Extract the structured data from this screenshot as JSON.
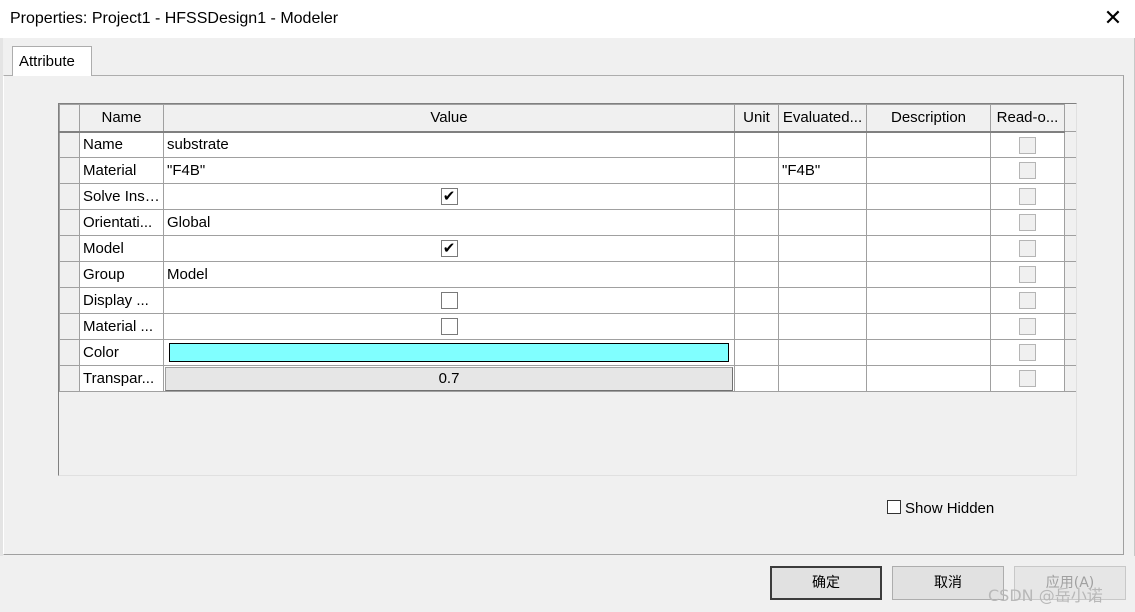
{
  "window": {
    "title": "Properties: Project1 - HFSSDesign1 - Modeler",
    "close_glyph": "✕"
  },
  "tabs": [
    {
      "label": "Attribute",
      "selected": true
    }
  ],
  "table": {
    "columns": [
      "Name",
      "Value",
      "Unit",
      "Evaluated...",
      "Description",
      "Read-o..."
    ],
    "rows": [
      {
        "name": "Name",
        "value": "substrate",
        "unit": "",
        "evaluated": "",
        "description": "",
        "readonly": false
      },
      {
        "name": "Material",
        "value": "\"F4B\"",
        "unit": "",
        "evaluated": "\"F4B\"",
        "description": "",
        "readonly": false
      },
      {
        "name": "Solve Insi...",
        "value": "",
        "value_checkbox": true,
        "unit": "",
        "evaluated": "",
        "description": "",
        "readonly": false
      },
      {
        "name": "Orientati...",
        "value": "Global",
        "unit": "",
        "evaluated": "",
        "description": "",
        "readonly": false
      },
      {
        "name": "Model",
        "value": "",
        "value_checkbox": true,
        "unit": "",
        "evaluated": "",
        "description": "",
        "readonly": false
      },
      {
        "name": "Group",
        "value": "Model",
        "unit": "",
        "evaluated": "",
        "description": "",
        "readonly": false
      },
      {
        "name": "Display ...",
        "value": "",
        "value_checkbox": false,
        "unit": "",
        "evaluated": "",
        "description": "",
        "readonly": false
      },
      {
        "name": "Material ...",
        "value": "",
        "value_checkbox": false,
        "unit": "",
        "evaluated": "",
        "description": "",
        "readonly": false
      },
      {
        "name": "Color",
        "value": "",
        "color": "#80ffff",
        "unit": "",
        "evaluated": "",
        "description": "",
        "readonly": false
      },
      {
        "name": "Transpar...",
        "value": "0.7",
        "unit": "",
        "evaluated": "",
        "description": "",
        "readonly": false
      }
    ]
  },
  "show_hidden": {
    "label": "Show Hidden",
    "checked": false
  },
  "buttons": {
    "ok": "确定",
    "cancel": "取消",
    "apply": "应用(A)"
  },
  "watermark": "CSDN @岳小诺",
  "checkmark_glyph": "✔"
}
